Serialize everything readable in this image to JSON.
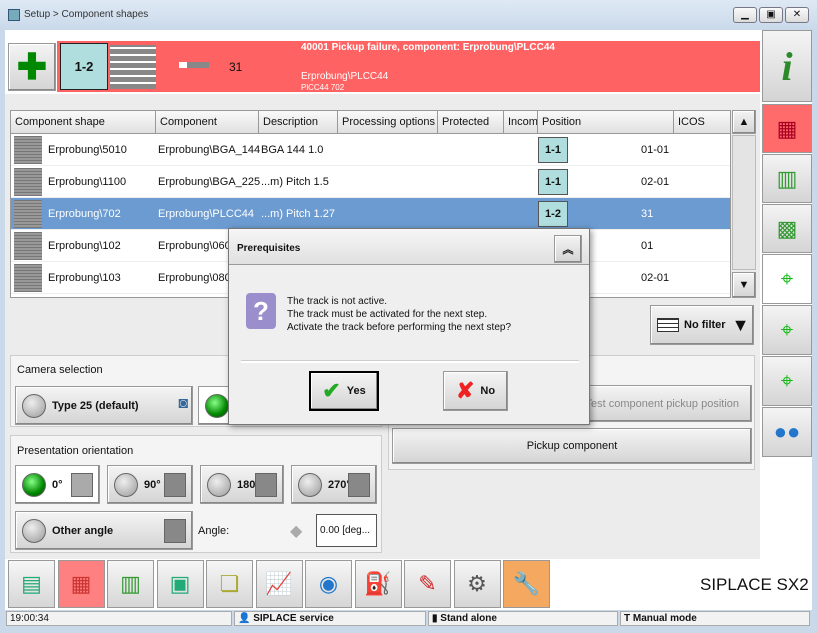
{
  "window": {
    "title": "Setup > Component shapes"
  },
  "banner": {
    "track": "1-2",
    "count": "31",
    "message": "40001 Pickup failure, component: Erprobung\\PLCC44",
    "component": "Erprobung\\PLCC44",
    "detail": "PlCC44 702",
    "color": "#ff6262"
  },
  "table": {
    "columns": [
      "Component shape",
      "Component",
      "Description",
      "Processing options",
      "Protected",
      "Incom",
      "Position",
      "ICOS"
    ],
    "rows": [
      {
        "shape": "Erprobung\\5010",
        "component": "Erprobung\\BGA_144",
        "description": "BGA 144 1.0",
        "track": "1-1",
        "pos": "01-01"
      },
      {
        "shape": "Erprobung\\1100",
        "component": "Erprobung\\BGA_225",
        "description": "...m)  Pitch 1.5",
        "track": "1-1",
        "pos": "02-01"
      },
      {
        "shape": "Erprobung\\702",
        "component": "Erprobung\\PLCC44",
        "description": "...m)  Pitch 1.27",
        "track": "1-2",
        "pos": "31"
      },
      {
        "shape": "Erprobung\\102",
        "component": "Erprobung\\0603",
        "description": "",
        "track": "",
        "pos": "01"
      },
      {
        "shape": "Erprobung\\103",
        "component": "Erprobung\\0805",
        "description": "",
        "track": "",
        "pos": "02-01"
      }
    ]
  },
  "filter": {
    "label": "No filter"
  },
  "camera": {
    "title": "Camera selection",
    "type25": "Type 25 (default)"
  },
  "actions": {
    "test": "Test component pickup position",
    "pickup": "Pickup component"
  },
  "orientation": {
    "title": "Presentation orientation",
    "options": [
      "0°",
      "90°",
      "180°",
      "270°"
    ],
    "other": "Other angle",
    "angle_label": "Angle:",
    "angle_value": "0.00 [deg..."
  },
  "dialog": {
    "title": "Prerequisites",
    "lines": [
      "The track is not active.",
      "The track must be activated for the next step.",
      "Activate the track before performing the next step?"
    ],
    "yes": "Yes",
    "no": "No"
  },
  "brand": "SIPLACE SX2",
  "status": {
    "time": "19:00:34",
    "user": "SIPLACE service",
    "mode": "Stand alone",
    "operation": "Manual mode"
  }
}
